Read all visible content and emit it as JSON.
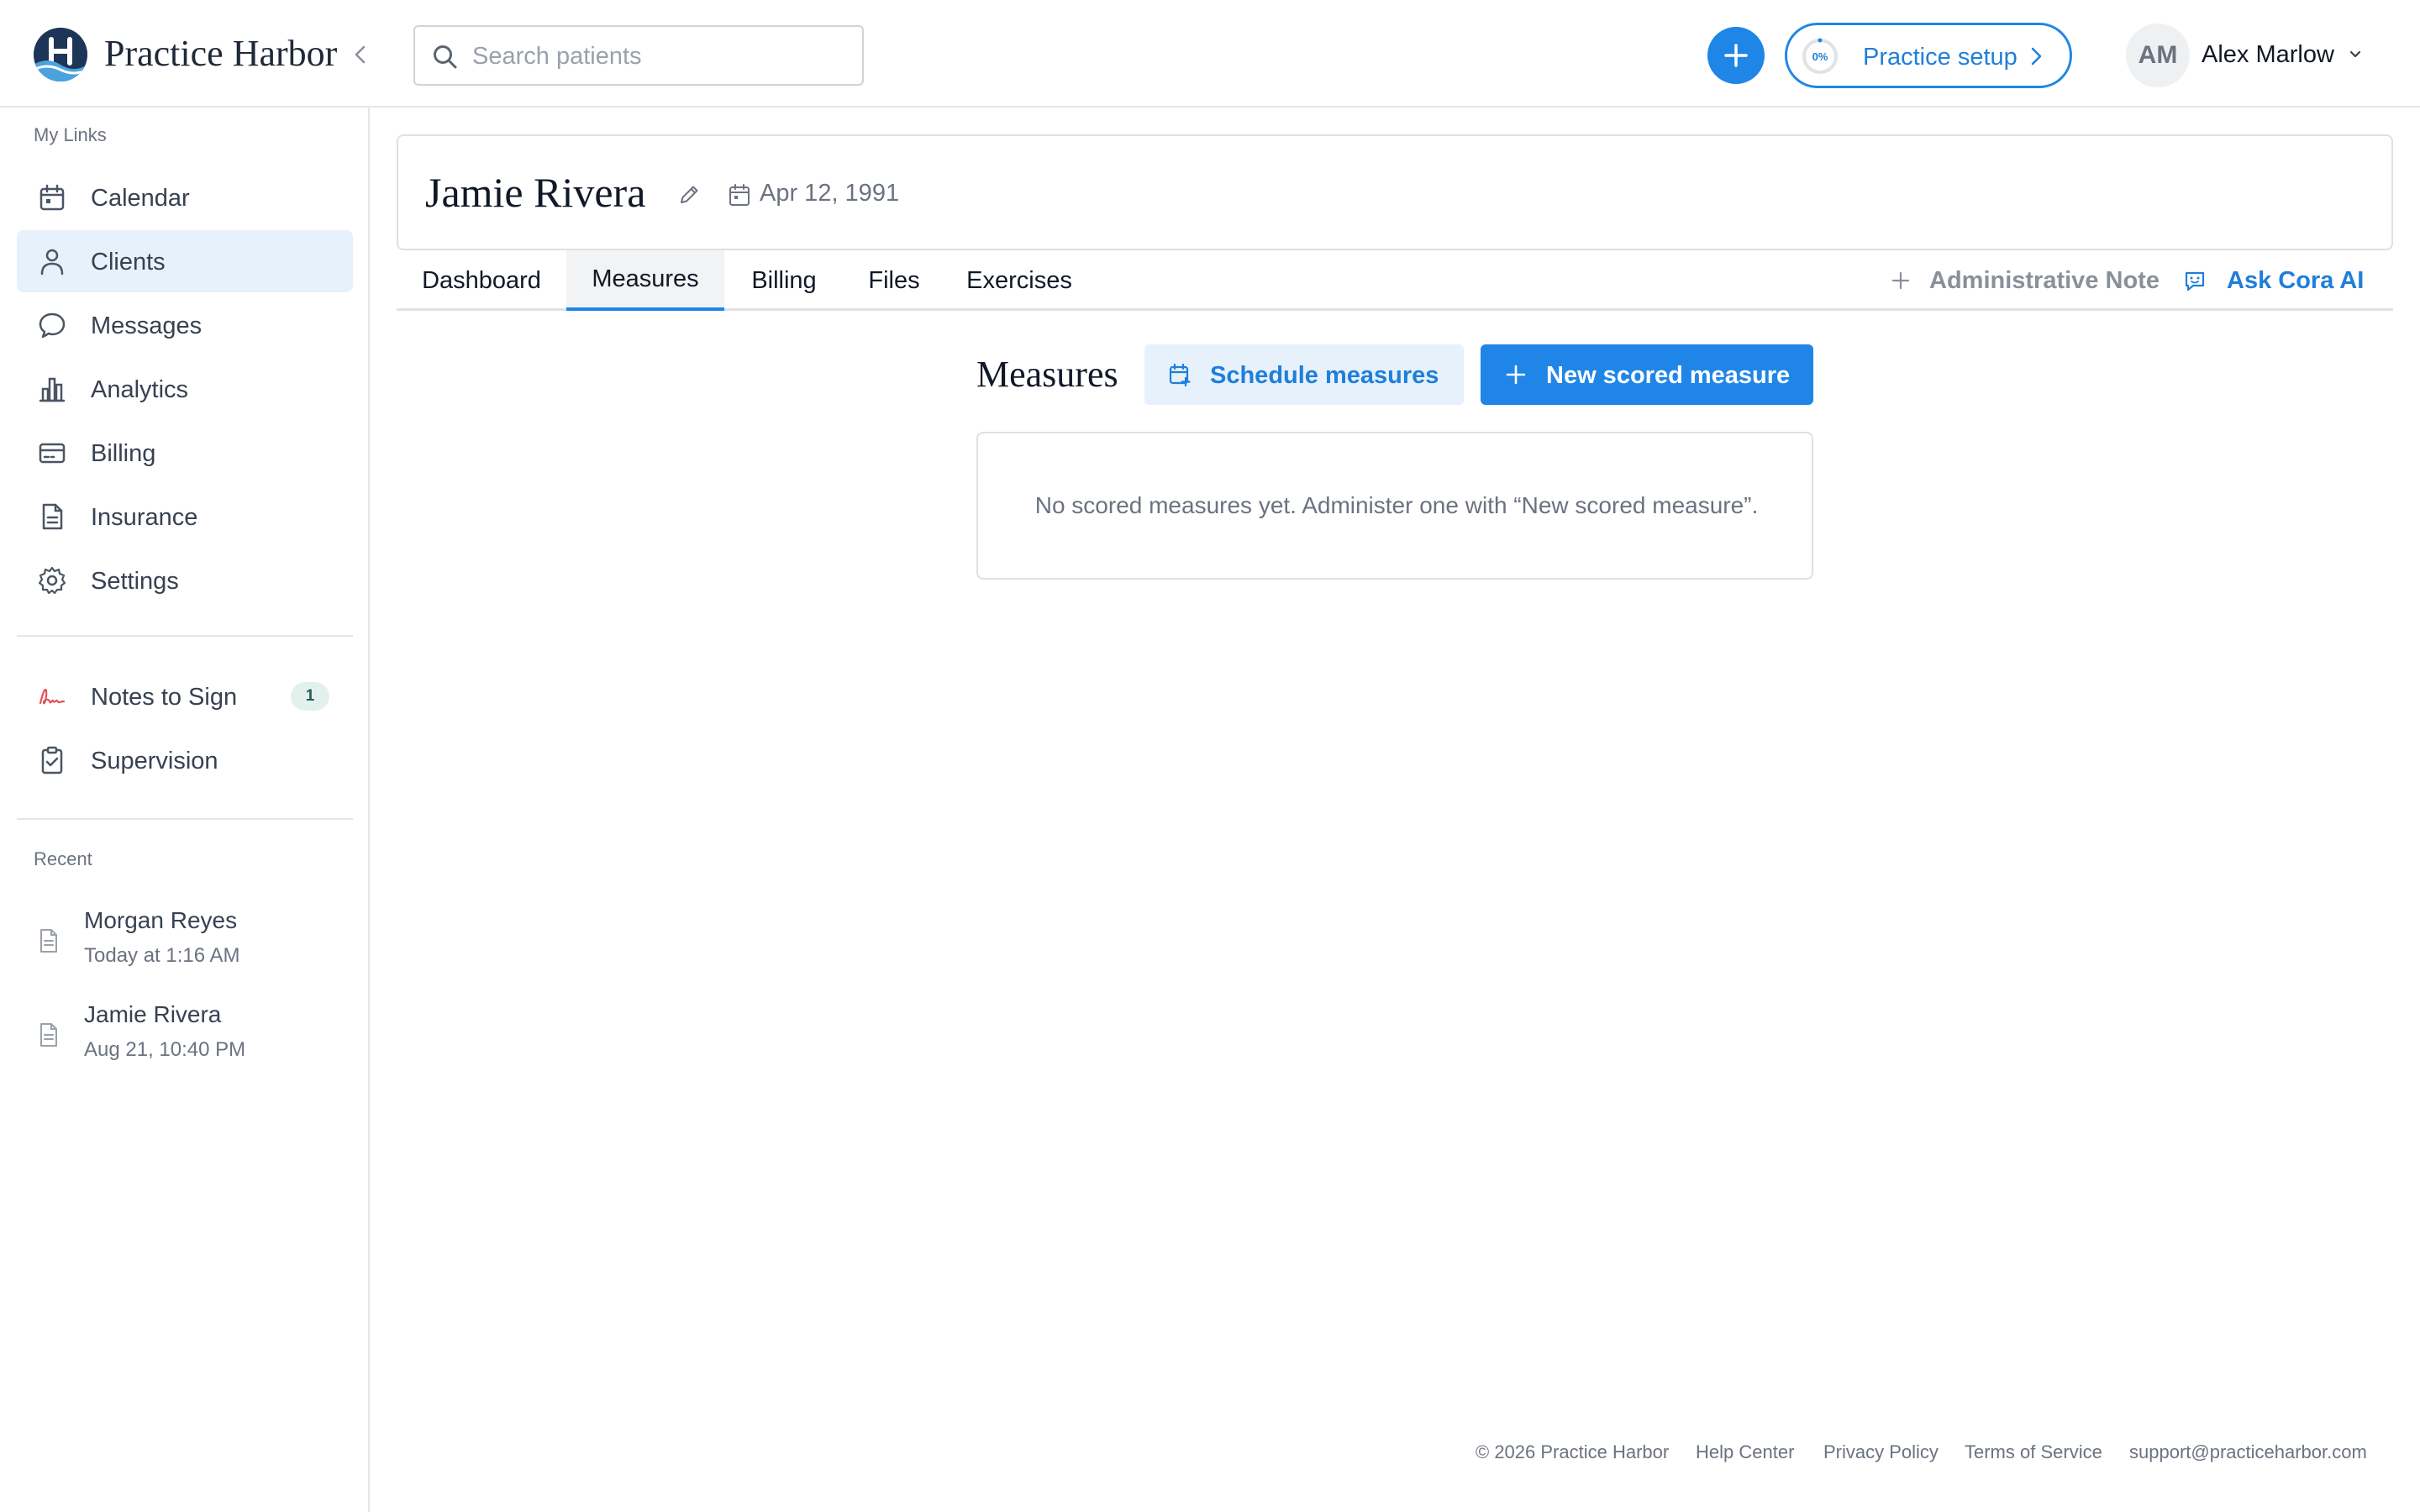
{
  "app": {
    "brand_name": "Practice Harbor",
    "accent_color": "#1f86e8"
  },
  "header": {
    "search_placeholder": "Search patients",
    "setup_label": "Practice setup",
    "setup_progress": "0%",
    "user_initials": "AM",
    "user_name": "Alex Marlow"
  },
  "sidebar": {
    "my_links_heading": "My Links",
    "items": [
      {
        "label": "Calendar",
        "icon": "calendar-icon"
      },
      {
        "label": "Clients",
        "icon": "person-icon",
        "active": true
      },
      {
        "label": "Messages",
        "icon": "chat-bubble-icon"
      },
      {
        "label": "Analytics",
        "icon": "bar-chart-icon"
      },
      {
        "label": "Billing",
        "icon": "card-icon"
      },
      {
        "label": "Insurance",
        "icon": "document-icon"
      },
      {
        "label": "Settings",
        "icon": "gear-icon"
      }
    ],
    "secondary": [
      {
        "label": "Notes to Sign",
        "icon": "signature-icon",
        "badge": "1"
      },
      {
        "label": "Supervision",
        "icon": "clipboard-check-icon"
      }
    ],
    "recent_heading": "Recent",
    "recent": [
      {
        "name": "Morgan Reyes",
        "time": "Today at 1:16 AM"
      },
      {
        "name": "Jamie Rivera",
        "time": "Aug 21, 10:40 PM"
      }
    ]
  },
  "patient": {
    "name": "Jamie Rivera",
    "dob": "Apr 12, 1991"
  },
  "tabs": [
    {
      "label": "Dashboard"
    },
    {
      "label": "Measures",
      "active": true
    },
    {
      "label": "Billing"
    },
    {
      "label": "Files"
    },
    {
      "label": "Exercises"
    }
  ],
  "actions": {
    "admin_note_label": "Administrative Note",
    "ask_ai_label": "Ask Cora AI"
  },
  "measures": {
    "title": "Measures",
    "schedule_label": "Schedule measures",
    "new_label": "New scored measure",
    "empty_text": "No scored measures yet. Administer one with “New scored measure”."
  },
  "footer": {
    "copyright": "© 2026 Practice Harbor",
    "links": [
      "Help Center",
      "Privacy Policy",
      "Terms of Service",
      "support@practiceharbor.com"
    ]
  }
}
